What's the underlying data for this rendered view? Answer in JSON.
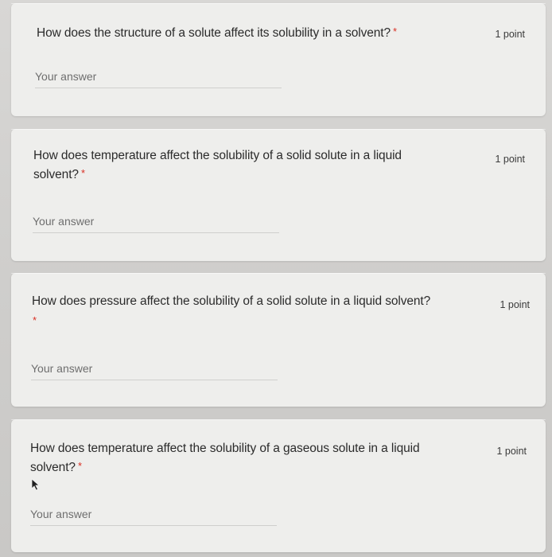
{
  "questions": [
    {
      "text": "How does the structure of a solute affect its solubility in a solvent?",
      "required_mark": "*",
      "points": "1 point",
      "answer_placeholder": "Your answer"
    },
    {
      "text_line1": "How does temperature affect the solubility of a solid solute in a liquid",
      "text_line2": "solvent?",
      "required_mark": "*",
      "points": "1 point",
      "answer_placeholder": "Your answer"
    },
    {
      "text": "How does pressure affect the solubility of a solid solute in a liquid solvent?",
      "required_mark": "*",
      "points": "1 point",
      "answer_placeholder": "Your answer"
    },
    {
      "text_line1": "How does temperature affect the solubility of a gaseous solute in a liquid",
      "text_line2": "solvent?",
      "required_mark": "*",
      "points": "1 point",
      "answer_placeholder": "Your answer"
    }
  ],
  "colors": {
    "required": "#d93025",
    "card_background": "#eeeeec",
    "page_background": "#d2d1cf"
  },
  "icons": {
    "pointer": "mouse-cursor-icon"
  }
}
